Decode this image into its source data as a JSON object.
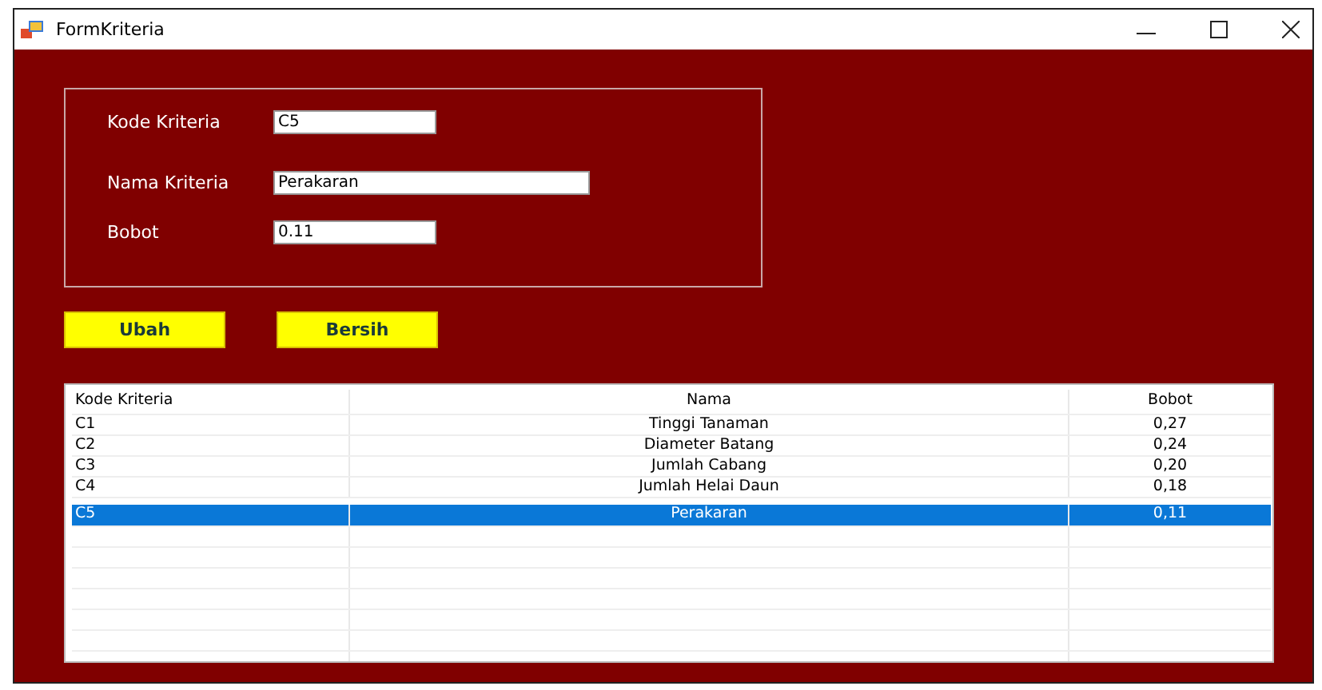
{
  "window": {
    "title": "FormKriteria"
  },
  "form": {
    "fields": [
      {
        "label": "Kode Kriteria",
        "value": "C5",
        "kind": "short"
      },
      {
        "label": "Nama Kriteria",
        "value": "Perakaran",
        "kind": "long"
      },
      {
        "label": "Bobot",
        "value": "0.11",
        "kind": "short"
      }
    ]
  },
  "buttons": [
    "Ubah",
    "Bersih"
  ],
  "table": {
    "columns": [
      "Kode Kriteria",
      "Nama",
      "Bobot"
    ],
    "rows": [
      {
        "cells": [
          "C1",
          "Tinggi Tanaman",
          "0,27"
        ],
        "selected": false
      },
      {
        "cells": [
          "C2",
          "Diameter Batang",
          "0,24"
        ],
        "selected": false
      },
      {
        "cells": [
          "C3",
          "Jumlah Cabang",
          "0,20"
        ],
        "selected": false
      },
      {
        "cells": [
          "C4",
          "Jumlah Helai Daun",
          "0,18"
        ],
        "selected": false
      },
      {
        "cells": [
          "C5",
          "Perakaran",
          "0,11"
        ],
        "selected": true
      }
    ]
  }
}
